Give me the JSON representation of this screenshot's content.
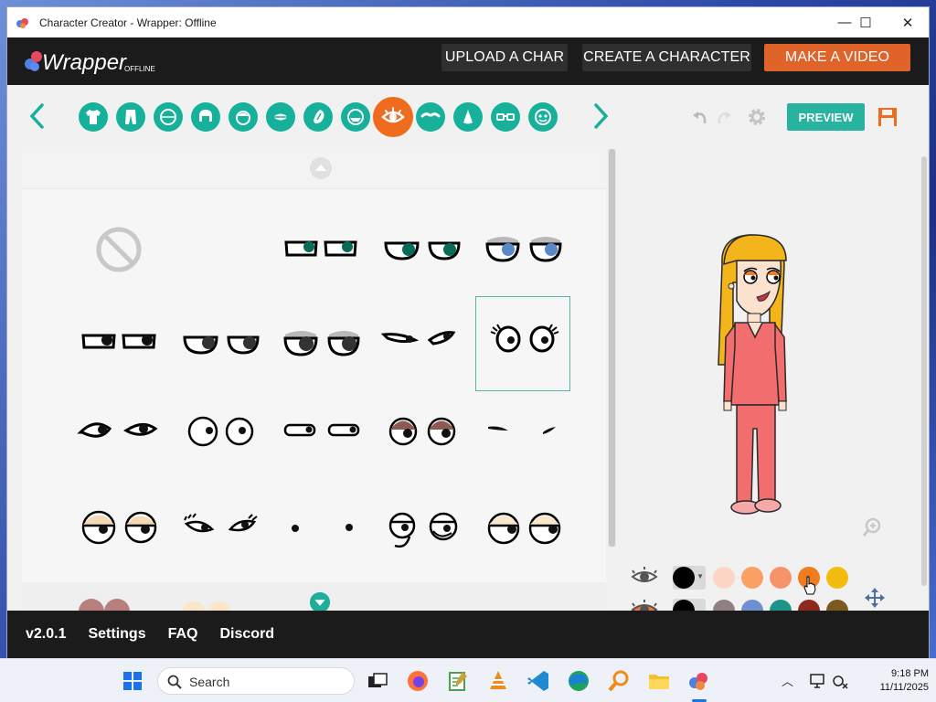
{
  "window": {
    "title": "Character Creator - Wrapper: Offline",
    "controls": {
      "minimize": "—",
      "maximize": "☐",
      "close": "✕"
    }
  },
  "header": {
    "logo_text": "Wrapper",
    "logo_sub": "OFFLINE",
    "buttons": [
      {
        "label": "UPLOAD A CHAR",
        "color": "#2f2f2f"
      },
      {
        "label": "CREATE A CHARACTER",
        "color": "#2f2f2f"
      },
      {
        "label": "MAKE A VIDEO",
        "color": "#e0632a"
      }
    ]
  },
  "categories": [
    {
      "name": "shirt",
      "active": false
    },
    {
      "name": "pants",
      "active": false
    },
    {
      "name": "face-shape",
      "active": false
    },
    {
      "name": "hair-back",
      "active": false
    },
    {
      "name": "hair-front",
      "active": false
    },
    {
      "name": "mouth",
      "active": false
    },
    {
      "name": "ear",
      "active": false
    },
    {
      "name": "facial-hair",
      "active": false
    },
    {
      "name": "eyes",
      "active": true
    },
    {
      "name": "eyebrows",
      "active": false
    },
    {
      "name": "nose",
      "active": false
    },
    {
      "name": "glasses",
      "active": false
    },
    {
      "name": "mask",
      "active": false
    }
  ],
  "toolbar": {
    "preview_label": "PREVIEW",
    "accent": "#17b09a",
    "active_color": "#ef6c1f"
  },
  "eye_grid": {
    "selected_index": 9,
    "items": [
      "none",
      "narrow-teal",
      "round-teal",
      "blue-lidded",
      "narrow-black",
      "round-black",
      "lidded-black",
      "sly-lashes",
      "lashes-round",
      "almond",
      "wide-round",
      "slit",
      "brown-lidded",
      "thin-lines",
      "peach-lidded",
      "long-lashes",
      "dot-eyes",
      "cheek-curl",
      "cream-lidded"
    ]
  },
  "color_rows": [
    {
      "icon": "eye-color-icon",
      "dropdown_color": "#000000",
      "swatches": [
        "#fdd5c5",
        "#f9a064",
        "#f6936b",
        "#ef7d1f",
        "#f2bd0f"
      ],
      "selected": 3
    },
    {
      "icon": "eye-color-icon",
      "dropdown_color": "#000000",
      "swatches": [
        "#8f7f7f",
        "#6f8fd0",
        "#1d9486",
        "#8c2a1d",
        "#7a5a1e"
      ],
      "selected": -1
    }
  ],
  "footer": {
    "version": "v2.0.1",
    "links": [
      "Settings",
      "FAQ",
      "Discord"
    ]
  },
  "taskbar": {
    "search_placeholder": "Search",
    "time": "9:18 PM",
    "date": "11/11/2025"
  }
}
